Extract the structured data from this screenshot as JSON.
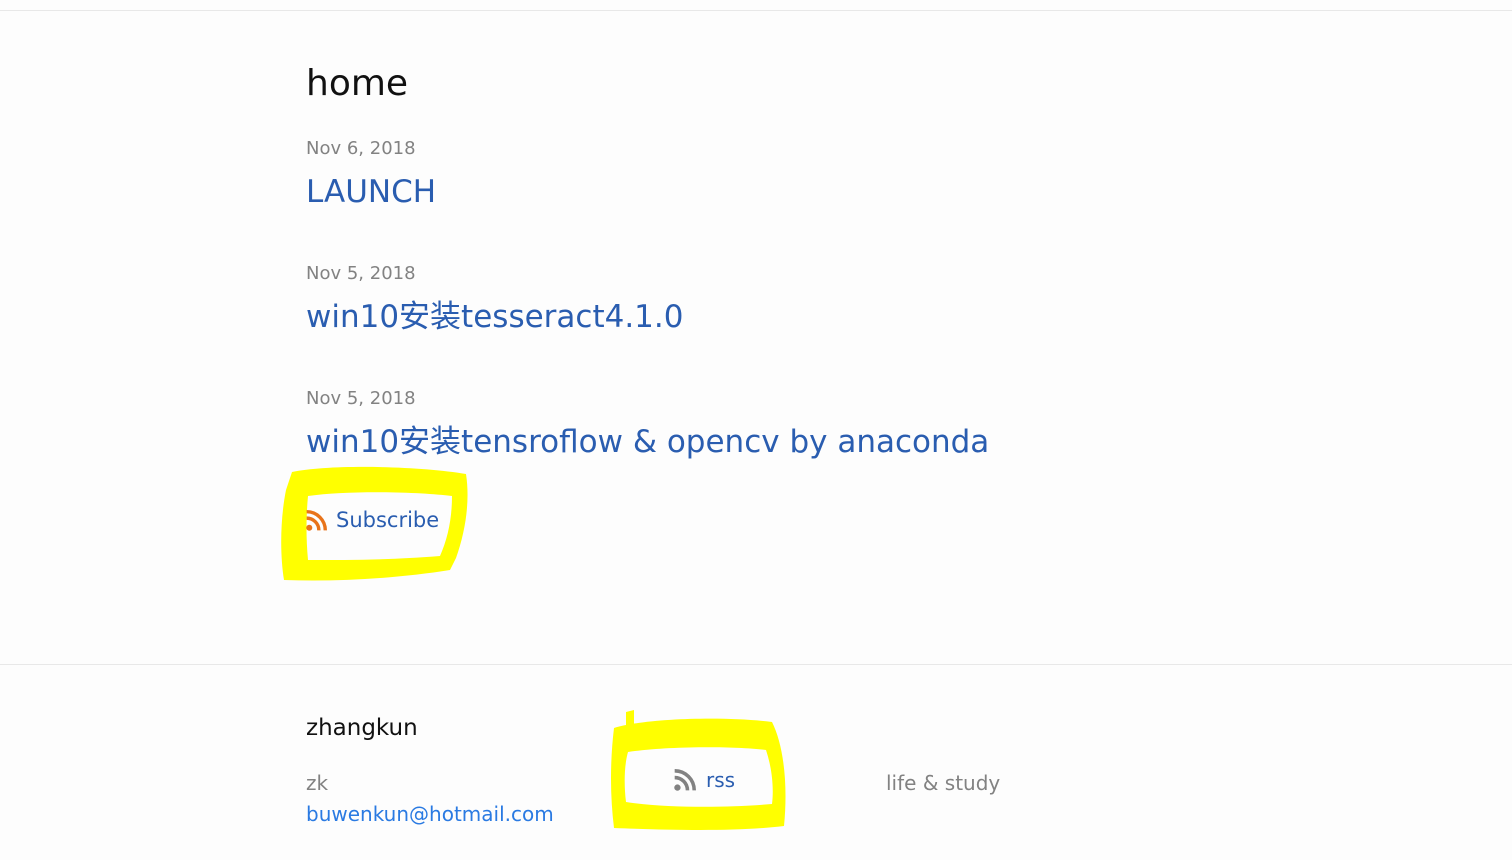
{
  "page": {
    "heading": "home"
  },
  "posts": [
    {
      "date": "Nov 6, 2018",
      "title": "LAUNCH"
    },
    {
      "date": "Nov 5, 2018",
      "title": "win10安装tesseract4.1.0"
    },
    {
      "date": "Nov 5, 2018",
      "title": "win10安装tensroflow & opencv by anaconda"
    }
  ],
  "subscribe": {
    "label": "Subscribe",
    "icon": "rss-icon",
    "icon_color": "#e8731a"
  },
  "footer": {
    "site_title": "zhangkun",
    "author_name": "zk",
    "email": "buwenkun@hotmail.com",
    "rss_label": "rss",
    "rss_icon": "rss-icon",
    "rss_icon_color": "#828282",
    "description": "life & study"
  },
  "annotations": {
    "highlight_color": "#ffff00"
  }
}
